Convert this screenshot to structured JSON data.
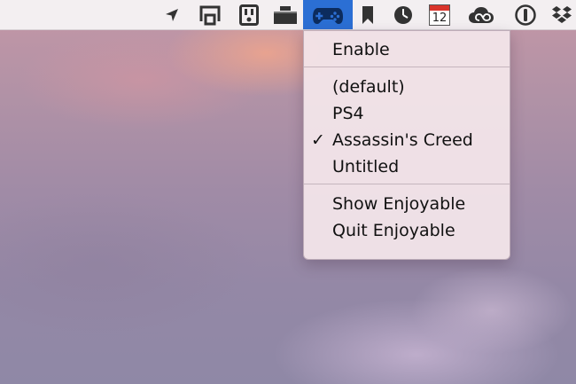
{
  "menubar": {
    "items": [
      {
        "name": "location",
        "icon": "location-arrow-icon"
      },
      {
        "name": "airplay",
        "icon": "airplay-icon"
      },
      {
        "name": "power-outlet",
        "icon": "power-outlet-icon"
      },
      {
        "name": "archive",
        "icon": "archive-box-icon"
      },
      {
        "name": "gamepad",
        "icon": "gamepad-icon",
        "active": true
      },
      {
        "name": "bookmark",
        "icon": "bookmark-icon"
      },
      {
        "name": "clock",
        "icon": "clock-icon"
      },
      {
        "name": "calendar",
        "icon": "calendar-icon",
        "day": "12"
      },
      {
        "name": "creative-cloud",
        "icon": "creative-cloud-icon"
      },
      {
        "name": "password",
        "icon": "password-keyhole-icon"
      },
      {
        "name": "dropbox",
        "icon": "dropbox-icon"
      }
    ],
    "active_color": "#2b6fd4"
  },
  "menu": {
    "enable_label": "Enable",
    "mappings": [
      {
        "label": "(default)",
        "checked": false
      },
      {
        "label": "PS4",
        "checked": false
      },
      {
        "label": "Assassin's Creed",
        "checked": true
      },
      {
        "label": "Untitled",
        "checked": false
      }
    ],
    "checkmark": "✓",
    "show_label": "Show Enjoyable",
    "quit_label": "Quit Enjoyable"
  }
}
